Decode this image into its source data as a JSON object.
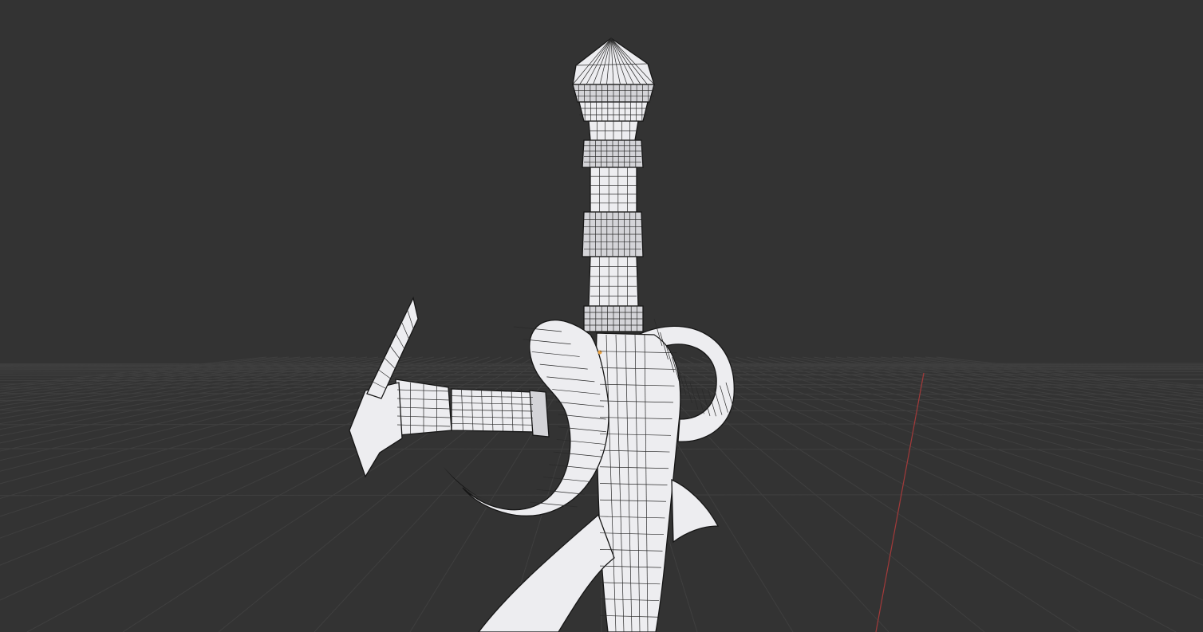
{
  "viewport": {
    "background": "#333333",
    "grid_color": "#3f3f3f",
    "x_axis_color": "#a33a3a",
    "mesh_color": "#ededf0",
    "wire_color": "#2a2a2a",
    "origin_color": "#e8a040"
  }
}
